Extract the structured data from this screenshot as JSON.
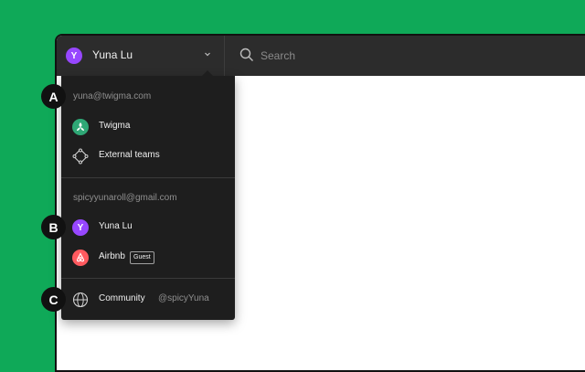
{
  "header": {
    "account": {
      "initial": "Y",
      "name": "Yuna Lu"
    },
    "search": {
      "placeholder": "Search",
      "value": ""
    }
  },
  "menu": {
    "section1": {
      "email": "yuna@twigma.com",
      "items": [
        {
          "label": "Twigma",
          "icon": "twigma-logo-icon"
        },
        {
          "label": "External teams",
          "icon": "external-teams-icon"
        }
      ]
    },
    "section2": {
      "email": "spicyyunaroll@gmail.com",
      "items": [
        {
          "label": "Yuna Lu",
          "icon": "avatar-icon",
          "initial": "Y"
        },
        {
          "label": "Airbnb",
          "icon": "airbnb-logo-icon",
          "badge": "Guest"
        }
      ]
    },
    "section3": {
      "items": [
        {
          "label": "Community",
          "icon": "globe-icon",
          "handle": "@spicyYuna"
        }
      ]
    }
  },
  "markers": {
    "a": "A",
    "b": "B",
    "c": "C"
  },
  "colors": {
    "background": "#0fa958",
    "topbar": "#2c2c2c",
    "menu": "#1e1e1e",
    "avatar": "#9747ff",
    "twigma": "#2fa876",
    "airbnb": "#ff5a5f"
  }
}
